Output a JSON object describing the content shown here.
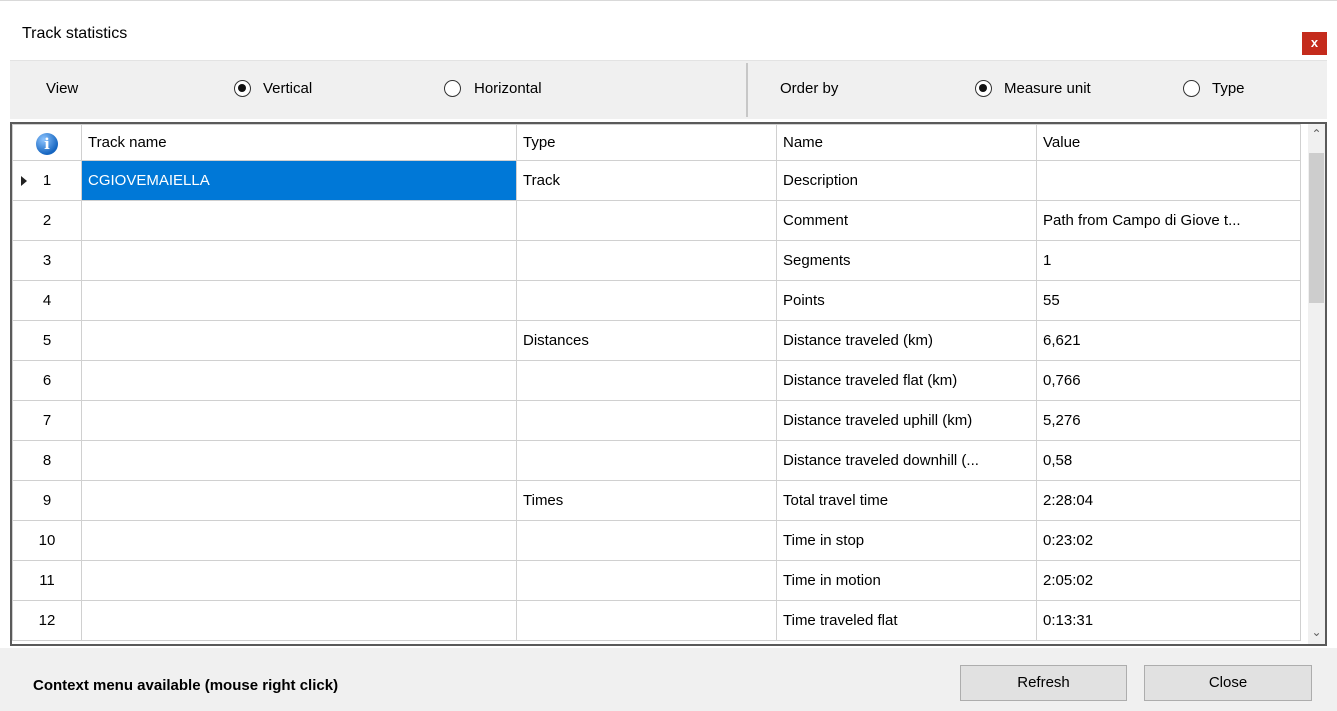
{
  "window": {
    "title": "Track statistics",
    "close_glyph": "x"
  },
  "options": {
    "view_label": "View",
    "view_vertical": "Vertical",
    "view_horizontal": "Horizontal",
    "view_selected": "Vertical",
    "order_label": "Order by",
    "order_measure": "Measure unit",
    "order_type": "Type",
    "order_selected": "Measure unit"
  },
  "grid": {
    "header_icon": "info-icon",
    "columns": [
      "Track name",
      "Type",
      "Name",
      "Value"
    ],
    "rows": [
      {
        "num": "1",
        "track": "CGIOVEMAIELLA",
        "type": "Track",
        "name": "Description",
        "value": ""
      },
      {
        "num": "2",
        "track": "",
        "type": "",
        "name": "Comment",
        "value": "Path from Campo di Giove t..."
      },
      {
        "num": "3",
        "track": "",
        "type": "",
        "name": "Segments",
        "value": "1"
      },
      {
        "num": "4",
        "track": "",
        "type": "",
        "name": "Points",
        "value": "55"
      },
      {
        "num": "5",
        "track": "",
        "type": "Distances",
        "name": "Distance traveled (km)",
        "value": "6,621"
      },
      {
        "num": "6",
        "track": "",
        "type": "",
        "name": "Distance traveled flat (km)",
        "value": "0,766"
      },
      {
        "num": "7",
        "track": "",
        "type": "",
        "name": "Distance traveled uphill (km)",
        "value": "5,276"
      },
      {
        "num": "8",
        "track": "",
        "type": "",
        "name": "Distance traveled downhill (...",
        "value": "0,58"
      },
      {
        "num": "9",
        "track": "",
        "type": "Times",
        "name": "Total travel time",
        "value": "2:28:04"
      },
      {
        "num": "10",
        "track": "",
        "type": "",
        "name": "Time in stop",
        "value": "0:23:02"
      },
      {
        "num": "11",
        "track": "",
        "type": "",
        "name": "Time in motion",
        "value": "2:05:02"
      },
      {
        "num": "12",
        "track": "",
        "type": "",
        "name": "Time traveled flat",
        "value": "0:13:31"
      }
    ]
  },
  "status": {
    "text": "Context menu available (mouse right click)"
  },
  "buttons": {
    "refresh": "Refresh",
    "close": "Close"
  }
}
